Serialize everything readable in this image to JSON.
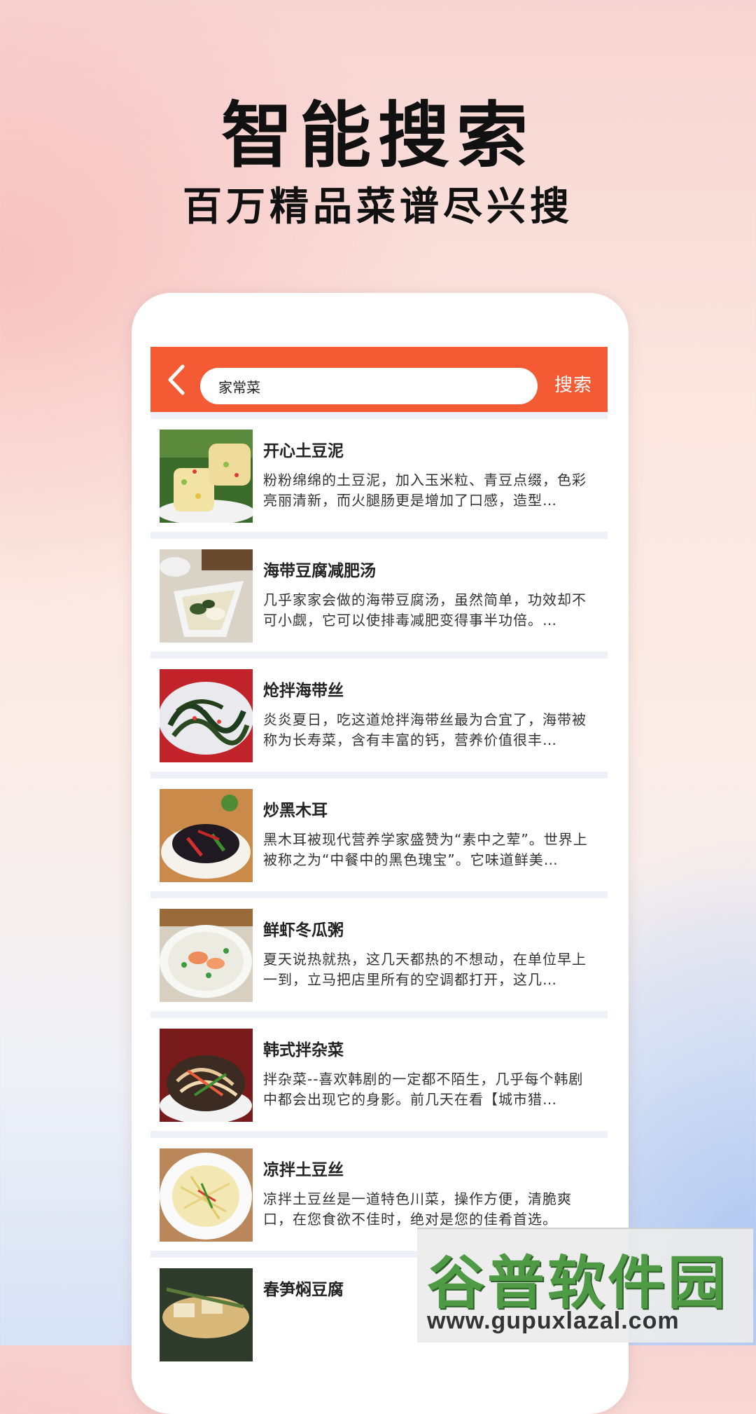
{
  "promo": {
    "title": "智能搜索",
    "subtitle": "百万精品菜谱尽兴搜"
  },
  "search": {
    "value": "家常菜",
    "button_label": "搜索",
    "bar_color": "#f45a34"
  },
  "results": [
    {
      "title": "开心土豆泥",
      "desc": "粉粉绵绵的土豆泥，加入玉米粒、青豆点缀，色彩亮丽清新，而火腿肠更是增加了口感，造型…",
      "image": "mashed-potato"
    },
    {
      "title": "海带豆腐减肥汤",
      "desc": "几乎家家会做的海带豆腐汤，虽然简单，功效却不可小觑，它可以使排毒减肥变得事半功倍。…",
      "image": "kelp-tofu-soup"
    },
    {
      "title": "炝拌海带丝",
      "desc": "炎炎夏日，吃这道炝拌海带丝最为合宜了，海带被称为长寿菜，含有丰富的钙，营养价值很丰…",
      "image": "kelp-salad"
    },
    {
      "title": "炒黑木耳",
      "desc": "黑木耳被现代营养学家盛赞为“素中之荤”。世界上被称之为“中餐中的黑色瑰宝”。它味道鲜美…",
      "image": "black-fungus"
    },
    {
      "title": "鲜虾冬瓜粥",
      "desc": "夏天说热就热，这几天都热的不想动，在单位早上一到，立马把店里所有的空调都打开，这几…",
      "image": "shrimp-porridge"
    },
    {
      "title": "韩式拌杂菜",
      "desc": "拌杂菜--喜欢韩剧的一定都不陌生，几乎每个韩剧中都会出现它的身影。前几天在看【城市猎…",
      "image": "japchae"
    },
    {
      "title": "凉拌土豆丝",
      "desc": "凉拌土豆丝是一道特色川菜，操作方便，清脆爽口，在您食欲不佳时，绝对是您的佳肴首选。",
      "image": "potato-shreds"
    },
    {
      "title": "春笋焖豆腐",
      "desc": "",
      "image": "bamboo-tofu"
    }
  ],
  "watermark": {
    "logo_text": "谷普软件园",
    "url": "www.gupuxlazal.com"
  }
}
